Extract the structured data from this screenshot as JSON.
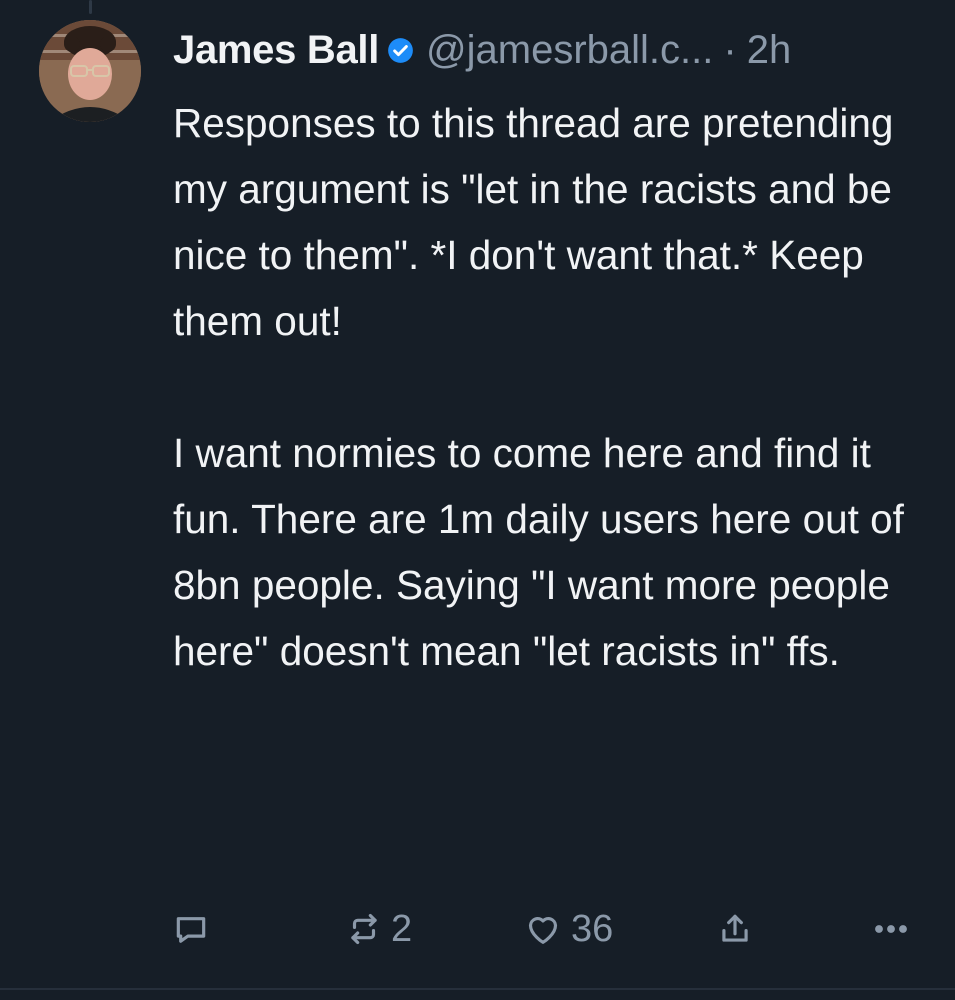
{
  "post": {
    "display_name": "James Ball",
    "handle": "@jamesrball.c...",
    "separator": "·",
    "time": "2h",
    "paragraphs": [
      "Responses to this thread are pretending my argument is \"let in the racists and be nice to them\". *I don't want that.* Keep them out!",
      "I want normies to come here and find it fun. There are 1m daily users here out of 8bn people. Saying \"I want more people here\" doesn't mean \"let racists in\" ffs."
    ],
    "stats": {
      "reposts": "2",
      "likes": "36"
    }
  },
  "icons": {
    "verified": "verified-badge-icon",
    "reply": "speech-bubble-icon",
    "repost": "repost-arrows-icon",
    "like": "heart-icon",
    "share": "share-upload-icon",
    "more": "ellipsis-icon"
  },
  "colors": {
    "background": "#161e27",
    "text": "#f1f3f5",
    "muted": "#8b99a9",
    "verified_blue": "#1d8cf8"
  }
}
